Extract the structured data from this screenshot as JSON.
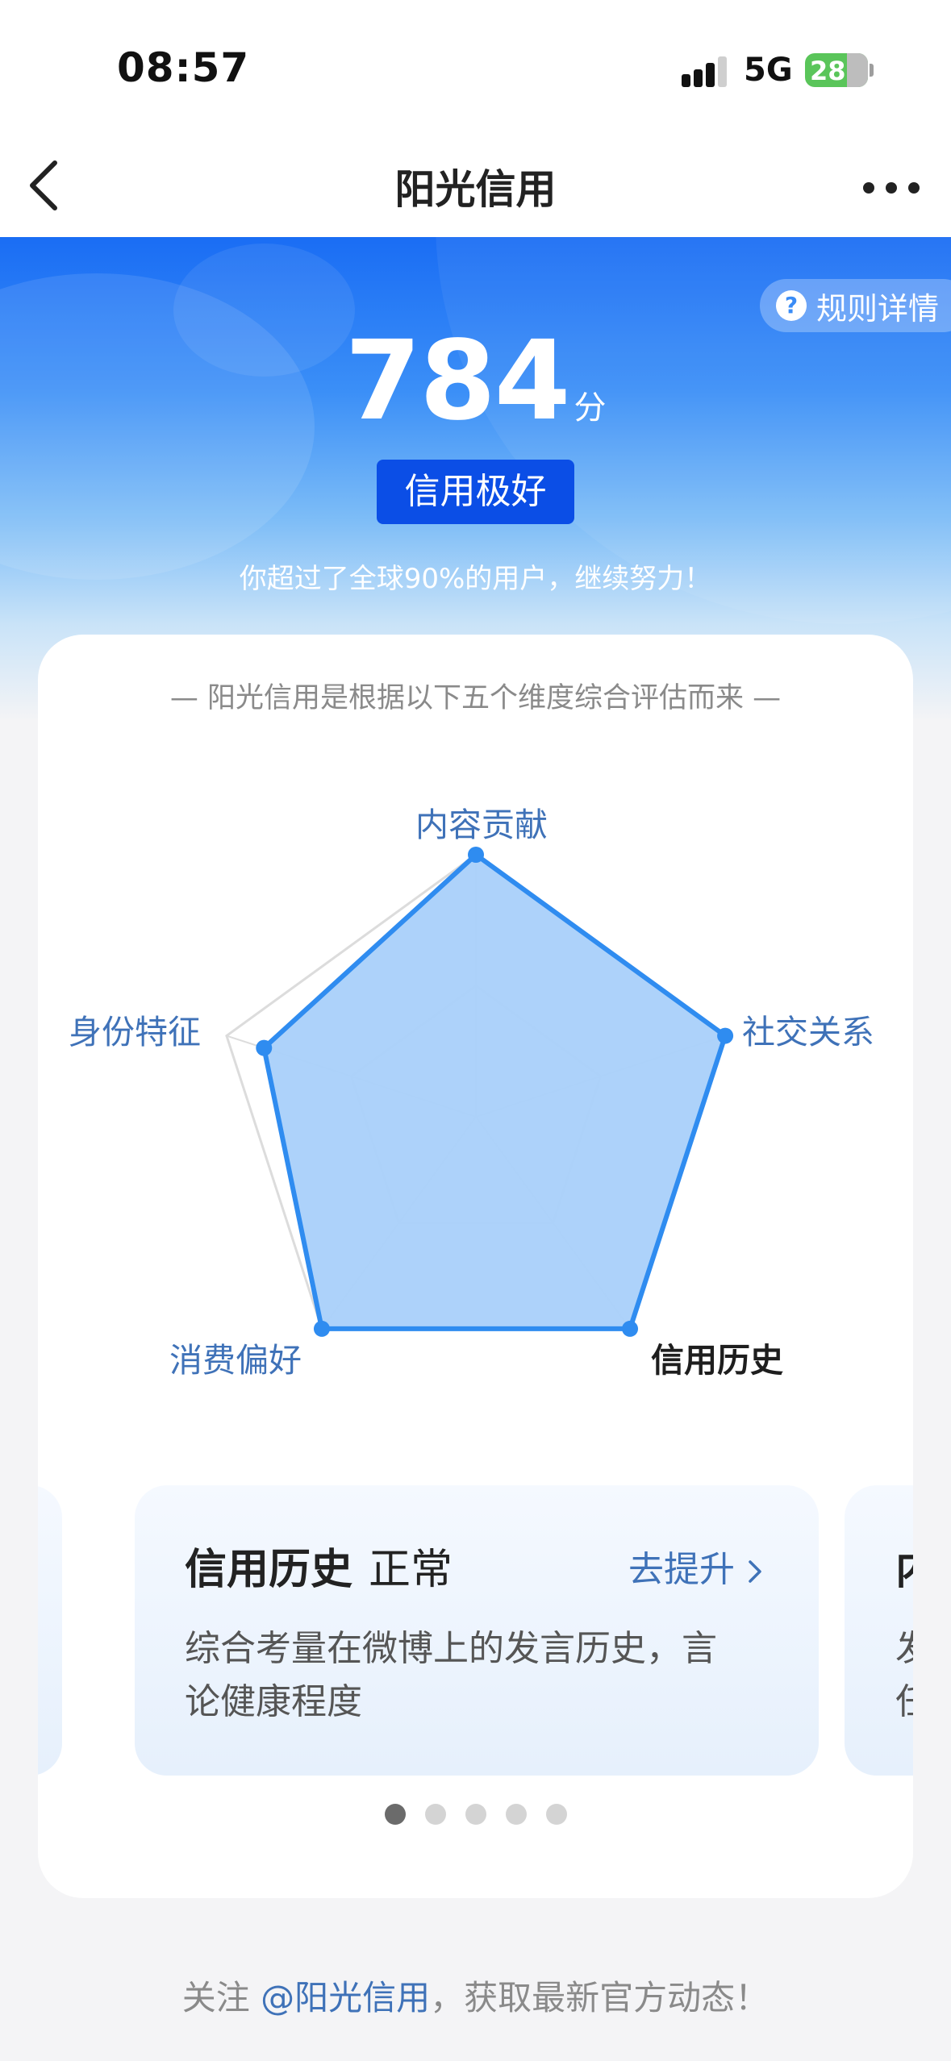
{
  "status_bar": {
    "time": "08:57",
    "network": "5G",
    "battery": "28"
  },
  "nav": {
    "title": "阳光信用"
  },
  "hero": {
    "rules_label": "规则详情",
    "score": "784",
    "score_unit": "分",
    "level": "信用极好",
    "tip": "你超过了全球90%的用户，继续努力！"
  },
  "radar": {
    "caption": "— 阳光信用是根据以下五个维度综合评估而来 —",
    "fill_color": "#a9d0fa",
    "line_color": "#2f8cf0",
    "dimensions": [
      {
        "label": "内容贡献",
        "value": 1.0
      },
      {
        "label": "社交关系",
        "value": 1.0
      },
      {
        "label": "信用历史",
        "value": 1.0
      },
      {
        "label": "消费偏好",
        "value": 1.0
      },
      {
        "label": "身份特征",
        "value": 0.85
      }
    ],
    "active_label": "信用历史"
  },
  "cards": {
    "current": {
      "title": "信用历史",
      "status": "正常",
      "action": "去提升",
      "description": "综合考量在微博上的发言历史，言论健康程度"
    },
    "next_peek": {
      "title": "内",
      "desc_lines": [
        "发",
        "任"
      ]
    },
    "page_count": 5,
    "active_page": 1
  },
  "footer": {
    "prefix": "关注 ",
    "link": "@阳光信用",
    "suffix": "，获取最新官方动态！"
  }
}
